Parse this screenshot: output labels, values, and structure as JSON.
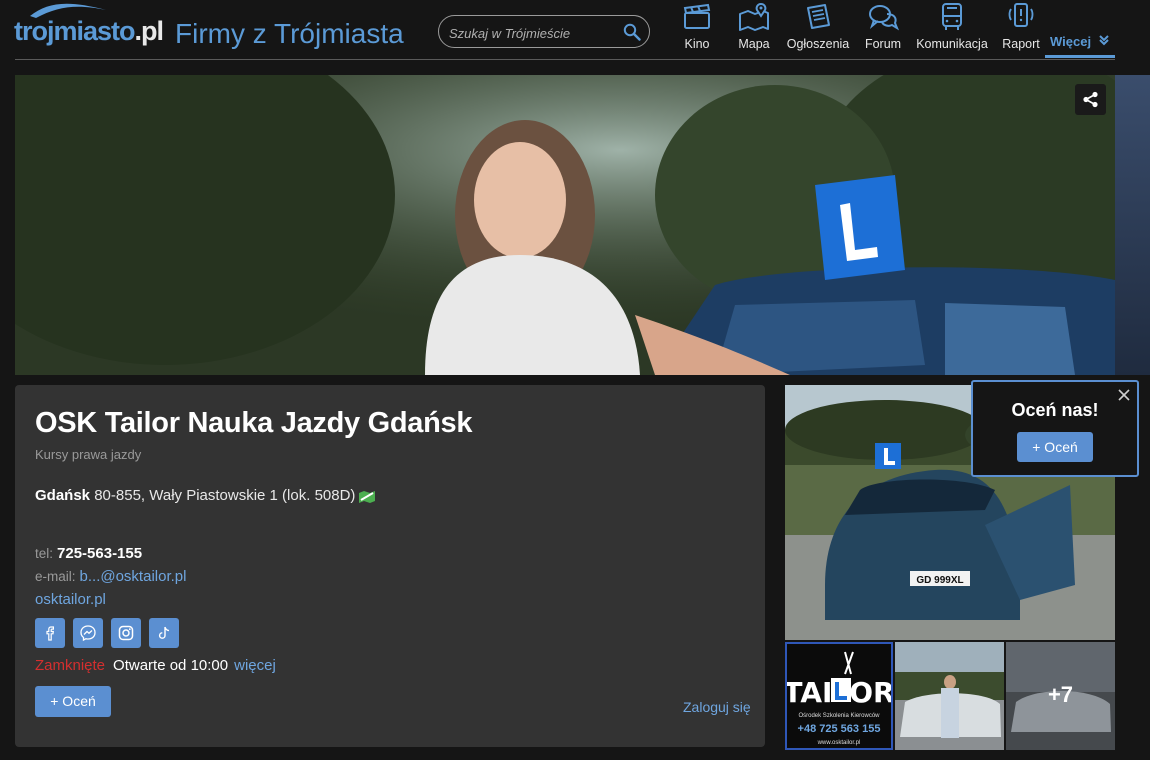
{
  "header": {
    "logo_main": "trojmiasto",
    "logo_tld": ".pl",
    "site_title": "Firmy z Trójmiasta",
    "search_placeholder": "Szukaj w Trójmieście",
    "nav": [
      {
        "label": "Kino",
        "icon": "clapperboard-icon"
      },
      {
        "label": "Mapa",
        "icon": "map-icon"
      },
      {
        "label": "Ogłoszenia",
        "icon": "classifieds-icon"
      },
      {
        "label": "Forum",
        "icon": "chat-bubbles-icon"
      },
      {
        "label": "Komunikacja",
        "icon": "bus-icon"
      },
      {
        "label": "Raport",
        "icon": "phone-alert-icon"
      }
    ],
    "more_label": "Więcej",
    "accent": "#5b9ad6"
  },
  "hero": {
    "image": "woman-with-driving-school-car-photo",
    "share_icon": "share-icon"
  },
  "business": {
    "name": "OSK Tailor Nauka Jazdy Gdańsk",
    "category": "Kursy prawa jazdy",
    "city": "Gdańsk",
    "address": "80-855, Wały Piastowskie 1 (lok. 508D)",
    "tel_label": "tel:",
    "tel": "725-563-155",
    "email_label": "e-mail:",
    "email": "b...@osktailor.pl",
    "website": "osktailor.pl",
    "social": [
      "facebook-icon",
      "messenger-icon",
      "instagram-icon",
      "tiktok-icon"
    ],
    "hours_status": "Zamknięte",
    "hours_next": "Otwarte od 10:00",
    "hours_more": "więcej",
    "rate_label": "+ Oceń",
    "login_label": "Zaloguj się"
  },
  "gallery": {
    "main_image": "driving-school-car-photo",
    "plate": "GD 999XL",
    "thumb_logo_text": "TAILOR",
    "thumb_logo_subtitle": "Ośrodek Szkolenia Kierowców",
    "thumb_logo_phone": "+48 725 563 155",
    "thumb_logo_url": "www.osktailor.pl",
    "more_count": "+7"
  },
  "popup": {
    "title": "Oceń nas!",
    "button": "+ Oceń"
  }
}
